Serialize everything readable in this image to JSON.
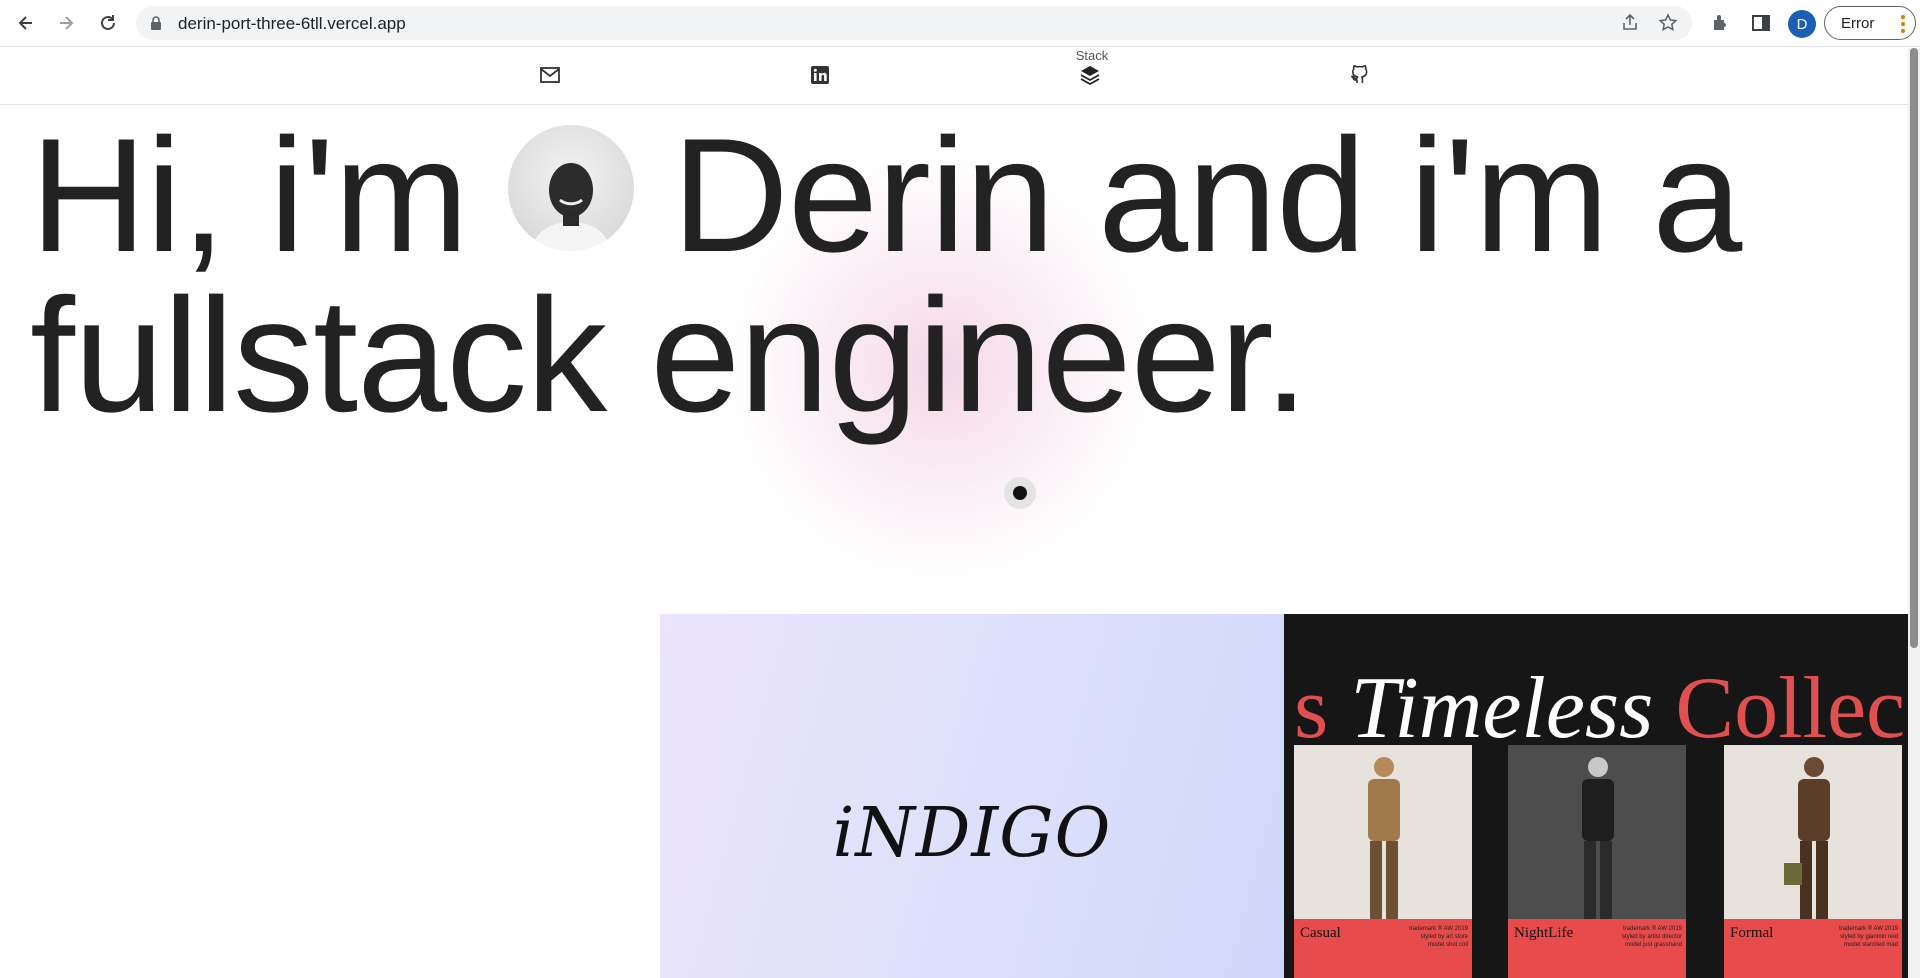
{
  "browser": {
    "url": "derin-port-three-6tll.vercel.app",
    "profile_initial": "D",
    "error_label": "Error"
  },
  "site_nav": {
    "items": [
      {
        "icon": "mail-icon"
      },
      {
        "icon": "linkedin-icon"
      },
      {
        "icon": "stack-icon",
        "label": "Stack"
      },
      {
        "icon": "github-icon"
      }
    ]
  },
  "hero": {
    "part1": "Hi, i'm",
    "part2": "Derin and i'm a",
    "line2": "fullstack engineer."
  },
  "projects": [
    {
      "title": "iNDIGO",
      "colors": {
        "from": "#ebe4fb",
        "to": "#cfd8fb"
      }
    },
    {
      "title_prefix": "s",
      "title_main": "Timeless",
      "title_suffix": "Collec",
      "looks": [
        {
          "name": "Casual",
          "desc": "trademark ® AW 2019 styled by art store model shot coll"
        },
        {
          "name": "NightLife",
          "desc": "trademark ® AW 2019 styled by artist director model just grasshand"
        },
        {
          "name": "Formal",
          "desc": "trademark ® AW 2019 styled by gianmin reid model starcited mad"
        }
      ],
      "colors": {
        "accent": "#e05050",
        "bg": "#161616"
      }
    }
  ]
}
